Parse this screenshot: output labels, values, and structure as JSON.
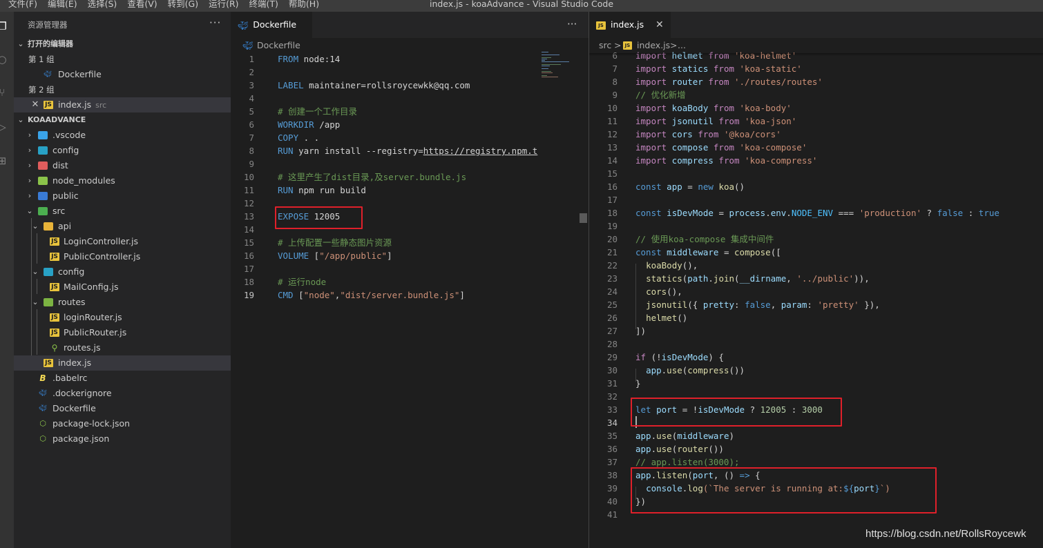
{
  "menubar": {
    "items": [
      "文件(F)",
      "编辑(E)",
      "选择(S)",
      "查看(V)",
      "转到(G)",
      "运行(R)",
      "终端(T)",
      "帮助(H)"
    ],
    "window_title": "index.js - koaAdvance - Visual Studio Code"
  },
  "sidebar": {
    "title": "资源管理器",
    "more": "···",
    "open_editors": {
      "header": "打开的编辑器",
      "group1": "第 1 组",
      "group1_file": "Dockerfile",
      "group2": "第 2 组",
      "group2_file": "index.js",
      "group2_desc": "src"
    },
    "project": {
      "header": "KOAADVANCE",
      "items": [
        {
          "label": "vscode_display",
          "text": ".vscode"
        },
        {
          "text": "config"
        },
        {
          "text": "dist"
        },
        {
          "text": "node_modules"
        },
        {
          "text": "public"
        },
        {
          "text": "src"
        },
        {
          "text": "api"
        },
        {
          "text": "LoginController.js"
        },
        {
          "text": "PublicController.js"
        },
        {
          "text": "config"
        },
        {
          "text": "MailConfig.js"
        },
        {
          "text": "routes"
        },
        {
          "text": "loginRouter.js"
        },
        {
          "text": "PublicRouter.js"
        },
        {
          "text": "routes.js"
        },
        {
          "text": "index.js"
        },
        {
          "text": ".babelrc"
        },
        {
          "text": ".dockerignore"
        },
        {
          "text": "Dockerfile"
        },
        {
          "text": "package-lock.json"
        },
        {
          "text": "package.json"
        }
      ]
    }
  },
  "editor_left": {
    "tab": "Dockerfile",
    "more": "···",
    "breadcrumb": "Dockerfile",
    "lines": [
      {
        "n": "1",
        "segs": [
          [
            "FROM",
            "kw"
          ],
          [
            " node:14",
            "p"
          ]
        ]
      },
      {
        "n": "2",
        "segs": []
      },
      {
        "n": "3",
        "segs": [
          [
            "LABEL",
            "kw"
          ],
          [
            " maintainer=rollsroycewkk@qq.com",
            "p"
          ]
        ]
      },
      {
        "n": "4",
        "segs": []
      },
      {
        "n": "5",
        "segs": [
          [
            "# 创建一个工作目录",
            "cm"
          ]
        ]
      },
      {
        "n": "6",
        "segs": [
          [
            "WORKDIR",
            "kw"
          ],
          [
            " /app",
            "p"
          ]
        ]
      },
      {
        "n": "7",
        "segs": [
          [
            "COPY",
            "kw"
          ],
          [
            " . .",
            "p"
          ]
        ]
      },
      {
        "n": "8",
        "segs": [
          [
            "RUN",
            "kw"
          ],
          [
            " yarn install --registry=",
            "p"
          ],
          [
            "https://registry.npm.t",
            "url"
          ]
        ]
      },
      {
        "n": "9",
        "segs": []
      },
      {
        "n": "10",
        "segs": [
          [
            "# 这里产生了dist目录,及server.bundle.js",
            "cm"
          ]
        ]
      },
      {
        "n": "11",
        "segs": [
          [
            "RUN",
            "kw"
          ],
          [
            " npm run build",
            "p"
          ]
        ]
      },
      {
        "n": "12",
        "segs": []
      },
      {
        "n": "13",
        "segs": [
          [
            "EXPOSE",
            "kw"
          ],
          [
            " 12005",
            "p"
          ]
        ]
      },
      {
        "n": "14",
        "segs": []
      },
      {
        "n": "15",
        "segs": [
          [
            "# 上传配置一些静态图片资源",
            "cm"
          ]
        ]
      },
      {
        "n": "16",
        "segs": [
          [
            "VOLUME",
            "kw"
          ],
          [
            " [",
            "p"
          ],
          [
            "\"/app/public\"",
            "str"
          ],
          [
            "]",
            "p"
          ]
        ]
      },
      {
        "n": "17",
        "segs": []
      },
      {
        "n": "18",
        "segs": [
          [
            "# 运行node",
            "cm"
          ]
        ]
      },
      {
        "n": "19",
        "segs": [
          [
            "CMD",
            "kw"
          ],
          [
            " [",
            "p"
          ],
          [
            "\"node\"",
            "str"
          ],
          [
            ",",
            "p"
          ],
          [
            "\"dist/server.bundle.js\"",
            "str"
          ],
          [
            "]",
            "p"
          ]
        ]
      }
    ]
  },
  "editor_right": {
    "tab": "index.js",
    "close": "✕",
    "breadcrumb": [
      "src",
      ">",
      "index.js",
      ">",
      "..."
    ],
    "lines": [
      {
        "n": "6",
        "segs": [
          [
            "import",
            "kw2"
          ],
          [
            " helmet ",
            "var"
          ],
          [
            "from",
            "kw2"
          ],
          [
            " 'koa-helmet'",
            "str"
          ]
        ]
      },
      {
        "n": "7",
        "segs": [
          [
            "import",
            "kw2"
          ],
          [
            " statics ",
            "var"
          ],
          [
            "from",
            "kw2"
          ],
          [
            " 'koa-static'",
            "str"
          ]
        ]
      },
      {
        "n": "8",
        "segs": [
          [
            "import",
            "kw2"
          ],
          [
            " router ",
            "var"
          ],
          [
            "from",
            "kw2"
          ],
          [
            " './routes/routes'",
            "str"
          ]
        ]
      },
      {
        "n": "9",
        "segs": [
          [
            "// 优化新增",
            "cm"
          ]
        ]
      },
      {
        "n": "10",
        "segs": [
          [
            "import",
            "kw2"
          ],
          [
            " koaBody ",
            "var"
          ],
          [
            "from",
            "kw2"
          ],
          [
            " 'koa-body'",
            "str"
          ]
        ]
      },
      {
        "n": "11",
        "segs": [
          [
            "import",
            "kw2"
          ],
          [
            " jsonutil ",
            "var"
          ],
          [
            "from",
            "kw2"
          ],
          [
            " 'koa-json'",
            "str"
          ]
        ]
      },
      {
        "n": "12",
        "segs": [
          [
            "import",
            "kw2"
          ],
          [
            " cors ",
            "var"
          ],
          [
            "from",
            "kw2"
          ],
          [
            " '@koa/cors'",
            "str"
          ]
        ]
      },
      {
        "n": "13",
        "segs": [
          [
            "import",
            "kw2"
          ],
          [
            " compose ",
            "var"
          ],
          [
            "from",
            "kw2"
          ],
          [
            " 'koa-compose'",
            "str"
          ]
        ]
      },
      {
        "n": "14",
        "segs": [
          [
            "import",
            "kw2"
          ],
          [
            " compress ",
            "var"
          ],
          [
            "from",
            "kw2"
          ],
          [
            " 'koa-compress'",
            "str"
          ]
        ]
      },
      {
        "n": "15",
        "segs": []
      },
      {
        "n": "16",
        "segs": [
          [
            "const",
            "kw"
          ],
          [
            " app ",
            "var"
          ],
          [
            "= ",
            "p"
          ],
          [
            "new",
            "kw"
          ],
          [
            " ",
            "p"
          ],
          [
            "koa",
            "fn"
          ],
          [
            "()",
            "p"
          ]
        ]
      },
      {
        "n": "17",
        "segs": []
      },
      {
        "n": "18",
        "segs": [
          [
            "const",
            "kw"
          ],
          [
            " isDevMode ",
            "var"
          ],
          [
            "= ",
            "p"
          ],
          [
            "process",
            "var"
          ],
          [
            ".",
            "p"
          ],
          [
            "env",
            "var"
          ],
          [
            ".",
            "p"
          ],
          [
            "NODE_ENV",
            "const"
          ],
          [
            " === ",
            "p"
          ],
          [
            "'production'",
            "str"
          ],
          [
            " ? ",
            "p"
          ],
          [
            "false",
            "kw"
          ],
          [
            " : ",
            "p"
          ],
          [
            "true",
            "kw"
          ]
        ]
      },
      {
        "n": "19",
        "segs": []
      },
      {
        "n": "20",
        "segs": [
          [
            "// 使用koa-compose 集成中间件",
            "cm"
          ]
        ]
      },
      {
        "n": "21",
        "segs": [
          [
            "const",
            "kw"
          ],
          [
            " middleware ",
            "var"
          ],
          [
            "= ",
            "p"
          ],
          [
            "compose",
            "fn"
          ],
          [
            "([",
            "p"
          ]
        ]
      },
      {
        "n": "22",
        "segs": [
          [
            "  ",
            "p"
          ],
          [
            "koaBody",
            "fn"
          ],
          [
            "(),",
            "p"
          ]
        ]
      },
      {
        "n": "23",
        "segs": [
          [
            "  ",
            "p"
          ],
          [
            "statics",
            "fn"
          ],
          [
            "(",
            "p"
          ],
          [
            "path",
            "var"
          ],
          [
            ".",
            "p"
          ],
          [
            "join",
            "fn"
          ],
          [
            "(",
            "p"
          ],
          [
            "__dirname",
            "var"
          ],
          [
            ", ",
            "p"
          ],
          [
            "'../public'",
            "str"
          ],
          [
            ")),",
            "p"
          ]
        ]
      },
      {
        "n": "24",
        "segs": [
          [
            "  ",
            "p"
          ],
          [
            "cors",
            "fn"
          ],
          [
            "(),",
            "p"
          ]
        ]
      },
      {
        "n": "25",
        "segs": [
          [
            "  ",
            "p"
          ],
          [
            "jsonutil",
            "fn"
          ],
          [
            "({ ",
            "p"
          ],
          [
            "pretty",
            "var"
          ],
          [
            ": ",
            "p"
          ],
          [
            "false",
            "kw"
          ],
          [
            ", ",
            "p"
          ],
          [
            "param",
            "var"
          ],
          [
            ": ",
            "p"
          ],
          [
            "'pretty'",
            "str"
          ],
          [
            " }),",
            "p"
          ]
        ]
      },
      {
        "n": "26",
        "segs": [
          [
            "  ",
            "p"
          ],
          [
            "helmet",
            "fn"
          ],
          [
            "()",
            "p"
          ]
        ]
      },
      {
        "n": "27",
        "segs": [
          [
            "])",
            "p"
          ]
        ]
      },
      {
        "n": "28",
        "segs": []
      },
      {
        "n": "29",
        "segs": [
          [
            "if",
            "kw2"
          ],
          [
            " (!",
            "p"
          ],
          [
            "isDevMode",
            "var"
          ],
          [
            ") {",
            "p"
          ]
        ]
      },
      {
        "n": "30",
        "segs": [
          [
            "  ",
            "p"
          ],
          [
            "app",
            "var"
          ],
          [
            ".",
            "p"
          ],
          [
            "use",
            "fn"
          ],
          [
            "(",
            "p"
          ],
          [
            "compress",
            "fn"
          ],
          [
            "())",
            "p"
          ]
        ]
      },
      {
        "n": "31",
        "segs": [
          [
            "}",
            "p"
          ]
        ]
      },
      {
        "n": "32",
        "segs": []
      },
      {
        "n": "33",
        "segs": [
          [
            "let",
            "kw"
          ],
          [
            " port ",
            "var"
          ],
          [
            "= !",
            "p"
          ],
          [
            "isDevMode",
            "var"
          ],
          [
            " ? ",
            "p"
          ],
          [
            "12005",
            "num"
          ],
          [
            " : ",
            "p"
          ],
          [
            "3000",
            "num"
          ]
        ]
      },
      {
        "n": "34",
        "segs": []
      },
      {
        "n": "35",
        "segs": [
          [
            "app",
            "var"
          ],
          [
            ".",
            "p"
          ],
          [
            "use",
            "fn"
          ],
          [
            "(",
            "p"
          ],
          [
            "middleware",
            "var"
          ],
          [
            ")",
            "p"
          ]
        ]
      },
      {
        "n": "36",
        "segs": [
          [
            "app",
            "var"
          ],
          [
            ".",
            "p"
          ],
          [
            "use",
            "fn"
          ],
          [
            "(",
            "p"
          ],
          [
            "router",
            "fn"
          ],
          [
            "())",
            "p"
          ]
        ]
      },
      {
        "n": "37",
        "segs": [
          [
            "// app.listen(3000);",
            "cm"
          ]
        ]
      },
      {
        "n": "38",
        "segs": [
          [
            "app",
            "var"
          ],
          [
            ".",
            "p"
          ],
          [
            "listen",
            "fn"
          ],
          [
            "(",
            "p"
          ],
          [
            "port",
            "var"
          ],
          [
            ", () ",
            "p"
          ],
          [
            "=>",
            "kw"
          ],
          [
            " {",
            "p"
          ]
        ]
      },
      {
        "n": "39",
        "segs": [
          [
            "  ",
            "p"
          ],
          [
            "console",
            "var"
          ],
          [
            ".",
            "p"
          ],
          [
            "log",
            "fn"
          ],
          [
            "(`The server is running at:",
            "str"
          ],
          [
            "${",
            "kw"
          ],
          [
            "port",
            "var"
          ],
          [
            "}",
            "kw"
          ],
          [
            "`)",
            "str"
          ]
        ]
      },
      {
        "n": "40",
        "segs": [
          [
            "})",
            "p"
          ]
        ]
      },
      {
        "n": "41",
        "segs": []
      }
    ]
  },
  "watermark": "https://blog.csdn.net/RollsRoycewk",
  "colors": {
    "kw": "#569cd6",
    "kw2": "#c586c0",
    "cm": "#6a9955",
    "str": "#ce9178",
    "var": "#9cdcfe",
    "fn": "#dcdcaa",
    "num": "#b5cea8",
    "const": "#4fc1ff",
    "p": "#d4d4d4",
    "url": "#d4d4d4",
    "highlight_box": "#e0202a"
  }
}
